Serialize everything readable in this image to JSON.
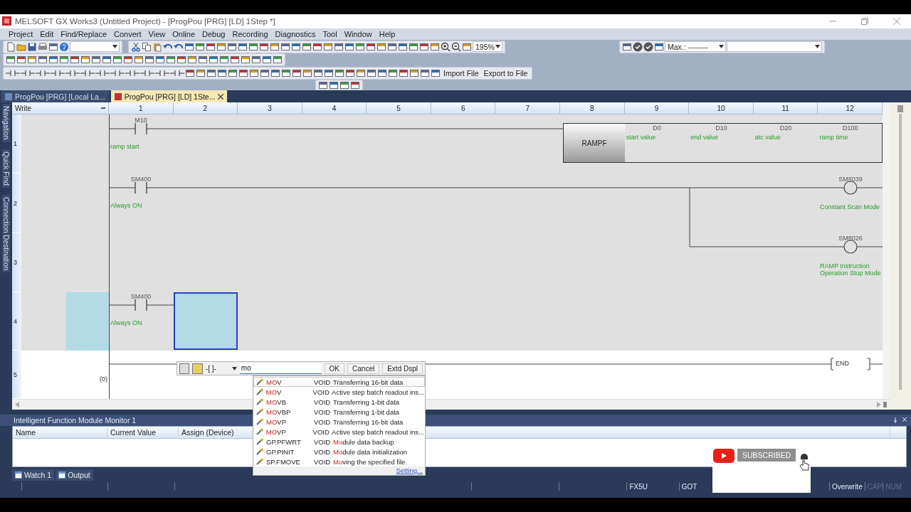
{
  "window": {
    "title": "MELSOFT GX Works3 (Untitled Project) - [ProgPou [PRG] [LD] 1Step *]"
  },
  "menu": [
    "Project",
    "Edit",
    "Find/Replace",
    "Convert",
    "View",
    "Online",
    "Debug",
    "Recording",
    "Diagnostics",
    "Tool",
    "Window",
    "Help"
  ],
  "toolbar": {
    "zoom": "195%",
    "max_label": "Max.: --------",
    "buttons": [
      "Import File",
      "Export to File"
    ]
  },
  "tabs": [
    {
      "label": "ProgPou [PRG] [Local La...",
      "selected": false
    },
    {
      "label": "ProgPou [PRG] [LD] 1Ste...",
      "selected": true
    }
  ],
  "side_panels": [
    "Navigation",
    "Quick Find",
    "Connection Destination"
  ],
  "ladder": {
    "mode": "Write",
    "columns": [
      "1",
      "2",
      "3",
      "4",
      "5",
      "6",
      "7",
      "8",
      "9",
      "10",
      "11",
      "12"
    ],
    "rungs": [
      {
        "kind": "function",
        "rows": [
          "1"
        ],
        "contact": {
          "device": "M10",
          "comment": "ramp start"
        },
        "instruction": "RAMPF",
        "operands": [
          {
            "device": "D0",
            "comment": "start value"
          },
          {
            "device": "D10",
            "comment": "end value"
          },
          {
            "device": "D20",
            "comment": "atc value"
          },
          {
            "device": "D100",
            "comment": "ramp time"
          }
        ]
      },
      {
        "kind": "coils",
        "rows": [
          "2",
          "3"
        ],
        "contact": {
          "device": "SM400",
          "comment": "Always ON"
        },
        "coils": [
          {
            "device": "SM8039",
            "comment": "Constant Scan Mode"
          },
          {
            "device": "SM8026",
            "comment": "RAMP Instruction Operation Stop Mode"
          }
        ]
      },
      {
        "kind": "editing",
        "rows": [
          "4"
        ],
        "contact": {
          "device": "SM400",
          "comment": "Always ON"
        }
      },
      {
        "kind": "end",
        "rows": [
          "5"
        ],
        "step": "(0)",
        "instruction": "END"
      }
    ]
  },
  "autocomplete": {
    "symbol": "-[ ]-",
    "input": "mo",
    "buttons": [
      "OK",
      "Cancel",
      "Extd Dspl"
    ],
    "items": [
      {
        "name": [
          {
            "text": "MO",
            "hit": true
          },
          {
            "text": "V",
            "hit": false
          }
        ],
        "type": "VOID",
        "description": [
          {
            "text": "Transferring 16-bit data",
            "hit": false
          }
        ],
        "selected": true
      },
      {
        "name": [
          {
            "text": "MO",
            "hit": true
          },
          {
            "text": "V",
            "hit": false
          }
        ],
        "type": "VOID",
        "description": [
          {
            "text": "Active step batch readout ins...",
            "hit": false
          }
        ],
        "selected": false
      },
      {
        "name": [
          {
            "text": "MO",
            "hit": true
          },
          {
            "text": "VB",
            "hit": false
          }
        ],
        "type": "VOID",
        "description": [
          {
            "text": "Transferring 1-bit data",
            "hit": false
          }
        ],
        "selected": false
      },
      {
        "name": [
          {
            "text": "MO",
            "hit": true
          },
          {
            "text": "VBP",
            "hit": false
          }
        ],
        "type": "VOID",
        "description": [
          {
            "text": "Transferring 1-bit data",
            "hit": false
          }
        ],
        "selected": false
      },
      {
        "name": [
          {
            "text": "MO",
            "hit": true
          },
          {
            "text": "VP",
            "hit": false
          }
        ],
        "type": "VOID",
        "description": [
          {
            "text": "Transferring 16-bit data",
            "hit": false
          }
        ],
        "selected": false
      },
      {
        "name": [
          {
            "text": "MO",
            "hit": true
          },
          {
            "text": "VP",
            "hit": false
          }
        ],
        "type": "VOID",
        "description": [
          {
            "text": "Active step batch readout ins...",
            "hit": false
          }
        ],
        "selected": false
      },
      {
        "name": [
          {
            "text": "GP.PFWRT",
            "hit": false
          }
        ],
        "type": "VOID",
        "description": [
          {
            "text": "Mo",
            "hit": true
          },
          {
            "text": "dule data backup",
            "hit": false
          }
        ],
        "selected": false
      },
      {
        "name": [
          {
            "text": "GP.PINIT",
            "hit": false
          }
        ],
        "type": "VOID",
        "description": [
          {
            "text": "Mo",
            "hit": true
          },
          {
            "text": "dule data initialization",
            "hit": false
          }
        ],
        "selected": false
      },
      {
        "name": [
          {
            "text": "SP.FMOVE",
            "hit": false
          }
        ],
        "type": "VOID",
        "description": [
          {
            "text": "Mo",
            "hit": true
          },
          {
            "text": "ving the specified file.",
            "hit": false
          }
        ],
        "selected": false
      }
    ],
    "link": "Setting..."
  },
  "monitor": {
    "title": "Intelligent Function Module Monitor 1",
    "columns": [
      "Name",
      "Current Value",
      "Assign (Device)"
    ]
  },
  "bottom_tabs": [
    {
      "label": "Watch 1",
      "selected": false
    },
    {
      "label": "Output",
      "selected": false
    }
  ],
  "status_bar": [
    {
      "text": "FX5U",
      "disabled": false
    },
    {
      "text": "GOT",
      "disabled": false
    },
    {
      "text": "Overwrite",
      "disabled": false
    },
    {
      "text": "CAP",
      "disabled": true
    },
    {
      "text": "NUM",
      "disabled": true
    }
  ],
  "subscribe_overlay": {
    "label": "SUBSCRIBED"
  }
}
